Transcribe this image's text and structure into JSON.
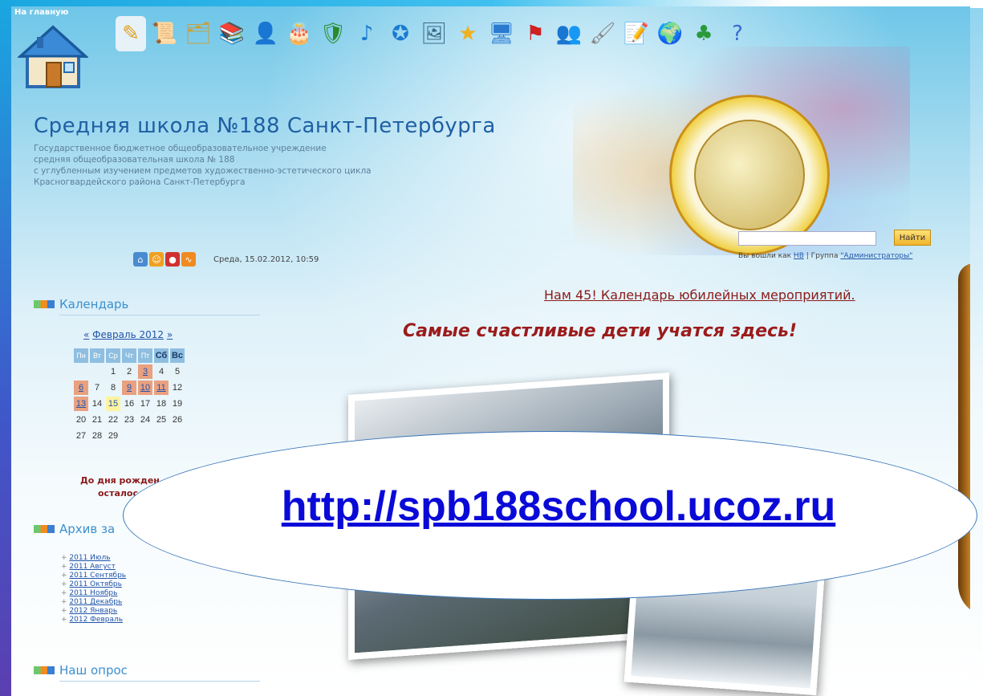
{
  "header": {
    "home_label": "На главную",
    "top_right_text": "До дня рождения школы"
  },
  "toolbar_icons": [
    {
      "name": "pencil-icon",
      "glyph": "✎",
      "bg": "#e7f1f8",
      "color": "#e0a020"
    },
    {
      "name": "scroll-icon",
      "glyph": "📜",
      "bg": "transparent",
      "color": "#b8860b"
    },
    {
      "name": "papers-icon",
      "glyph": "🗂",
      "bg": "transparent",
      "color": "#c8a040"
    },
    {
      "name": "books-icon",
      "glyph": "📚",
      "bg": "transparent",
      "color": "#b22222"
    },
    {
      "name": "person-icon",
      "glyph": "👤",
      "bg": "transparent",
      "color": "#d08020"
    },
    {
      "name": "cake-icon",
      "glyph": "🎂",
      "bg": "transparent",
      "color": "#d4a040"
    },
    {
      "name": "shield-icon",
      "glyph": "🛡",
      "bg": "transparent",
      "color": "#2a8a2a"
    },
    {
      "name": "music-note-icon",
      "glyph": "♪",
      "bg": "transparent",
      "color": "#1a7ad0"
    },
    {
      "name": "star-badge-icon",
      "glyph": "✪",
      "bg": "transparent",
      "color": "#1a7ad0"
    },
    {
      "name": "photos-icon",
      "glyph": "🖼",
      "bg": "transparent",
      "color": "#3a6a8a"
    },
    {
      "name": "star-icon",
      "glyph": "★",
      "bg": "transparent",
      "color": "#f0b020"
    },
    {
      "name": "monitor-icon",
      "glyph": "🖥",
      "bg": "transparent",
      "color": "#2a7ad0"
    },
    {
      "name": "flag-icon",
      "glyph": "⚑",
      "bg": "transparent",
      "color": "#d02020"
    },
    {
      "name": "people-icon",
      "glyph": "👥",
      "bg": "transparent",
      "color": "#3aa03a"
    },
    {
      "name": "brush-icon",
      "glyph": "🖌",
      "bg": "transparent",
      "color": "#888888"
    },
    {
      "name": "document-icon",
      "glyph": "📝",
      "bg": "transparent",
      "color": "#666666"
    },
    {
      "name": "globe-icon",
      "glyph": "🌍",
      "bg": "transparent",
      "color": "#2a8a2a"
    },
    {
      "name": "green-person-icon",
      "glyph": "♣",
      "bg": "transparent",
      "color": "#2a9a3a"
    },
    {
      "name": "help-icon",
      "glyph": "?",
      "bg": "transparent",
      "color": "#3a6ad0"
    }
  ],
  "site": {
    "title": "Средняя школа №188 Санкт-Петербурга",
    "subtitle_lines": [
      "Государственное бюджетное общеобразовательное учреждение",
      "средняя общеобразовательная школа № 188",
      "с углубленным изучением предметов художественно-эстетического цикла",
      "Красногвардейского района Санкт-Петербурга"
    ]
  },
  "search": {
    "placeholder": "",
    "button_label": "Найти"
  },
  "login": {
    "prefix": "Вы вошли как",
    "user": "НВ",
    "sep": "| Группа",
    "group": "\"Администраторы\""
  },
  "date_text": "Среда, 15.02.2012, 10:59",
  "headlines": {
    "anniversary": "Нам 45! Календарь юбилейных мероприятий.",
    "motto": "Самые счастливые дети учатся здесь!"
  },
  "sidebar": {
    "calendar_title": "Календарь",
    "calendar_prev": "«",
    "calendar_month": "Февраль 2012",
    "calendar_next": "»",
    "weekdays": [
      "Пн",
      "Вт",
      "Ср",
      "Чт",
      "Пт",
      "Сб",
      "Вс"
    ],
    "weeks": [
      [
        "",
        "",
        "1",
        "2",
        "3",
        "4",
        "5"
      ],
      [
        "6",
        "7",
        "8",
        "9",
        "10",
        "11",
        "12"
      ],
      [
        "13",
        "14",
        "15",
        "16",
        "17",
        "18",
        "19"
      ],
      [
        "20",
        "21",
        "22",
        "23",
        "24",
        "25",
        "26"
      ],
      [
        "27",
        "28",
        "29",
        "",
        "",
        "",
        ""
      ]
    ],
    "birthday_line1": "До дня рожден",
    "birthday_line2": "осталос",
    "archive_title": "Архив за",
    "archive_items": [
      "2011 Июль",
      "2011 Август",
      "2011 Сентябрь",
      "2011 Октябрь",
      "2011 Ноябрь",
      "2011 Декабрь",
      "2012 Январь",
      "2012 Февраль"
    ],
    "poll_title": "Наш опрос"
  },
  "overlay": {
    "url": "http://spb188school.ucoz.ru"
  },
  "colors": {
    "title_blue": "#1f5fa3",
    "link_blue": "#0a0ad8",
    "headline_red": "#8b1a1a",
    "calendar_mark": "#e9a180"
  }
}
